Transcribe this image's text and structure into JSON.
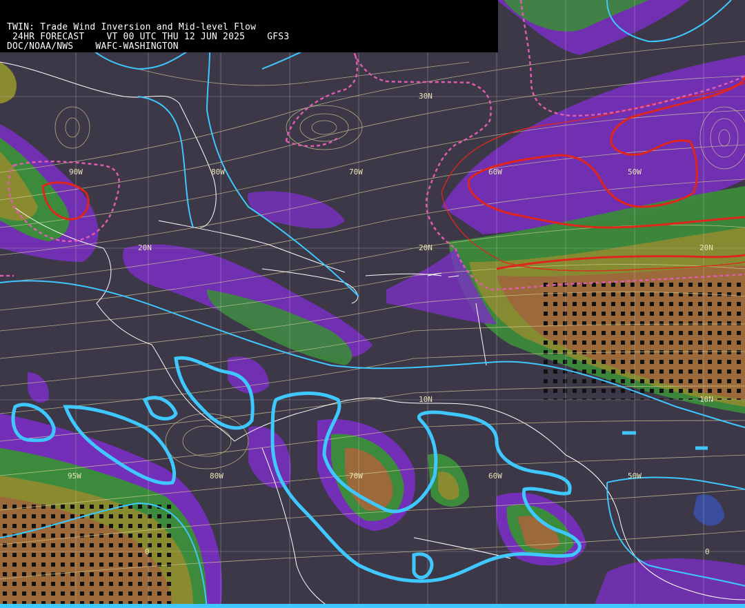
{
  "header": {
    "line1": "TWIN: Trade Wind Inversion and Mid-level Flow",
    "line2": " 24HR FORECAST    VT 00 UTC THU 12 JUN 2025    GFS3",
    "line3": "DOC/NOAA/NWS    WAFC-WASHINGTON"
  },
  "labels": {
    "lat_30n": "30N",
    "lat_20n_west": "20N",
    "lat_20n_mid": "20N",
    "lat_20n_east": "20N",
    "lat_10n_mid": "10N",
    "lat_10n_east": "10N",
    "lon_90w": "90W",
    "lon_80w": "80W",
    "lon_70w": "70W",
    "lon_60w": "60W",
    "lon_50w": "50W",
    "lon_95w_south": "95W",
    "lon_80w_south": "80W",
    "lon_70w_south": "70W",
    "lon_60w_south": "60W",
    "lon_50w_south": "50W",
    "zero_a": "0",
    "zero_b": "0"
  },
  "colors": {
    "background": "#3d3847",
    "purple_shade": "#7a2fc4",
    "blue_shade": "#3a4c9c",
    "green_shade": "#3c8a3c",
    "olive_shade": "#8a8a30",
    "brown_shade": "#9c6a3a",
    "streamline": "#d8d49a",
    "cyan_contour": "#3ec8ff",
    "red_contour": "#e0261c",
    "pink_dashed": "#e05cb0",
    "coastline": "#ffffff",
    "grid": "#c8c8c8"
  }
}
